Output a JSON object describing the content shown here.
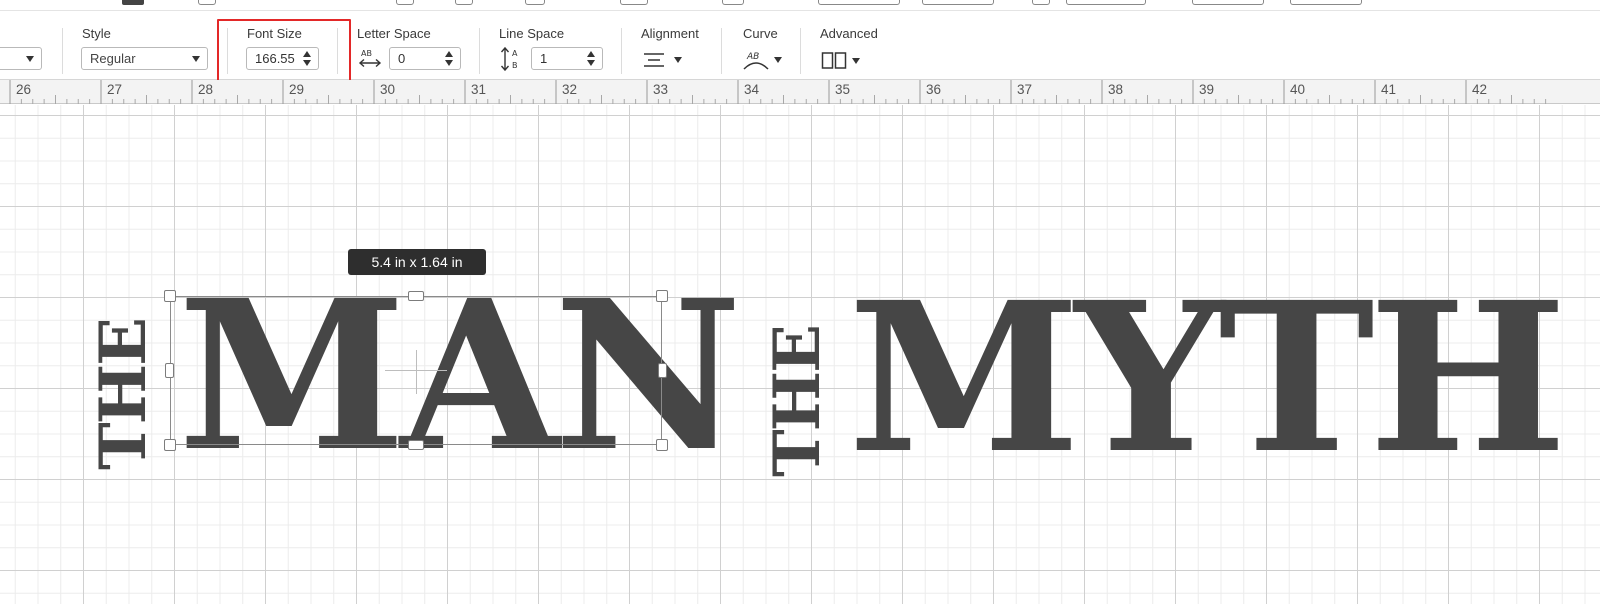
{
  "toolbar": {
    "font_dropdown": {
      "value": ""
    },
    "style": {
      "label": "Style",
      "value": "Regular"
    },
    "font_size": {
      "label": "Font Size",
      "value": "166.55"
    },
    "letter_space": {
      "label": "Letter Space",
      "value": "0",
      "icon": "letter-space-icon",
      "icon_text": "AB"
    },
    "line_space": {
      "label": "Line Space",
      "value": "1",
      "icon": "line-space-icon",
      "icon_text_a": "A",
      "icon_text_b": "B"
    },
    "alignment": {
      "label": "Alignment",
      "icon": "align-center-icon"
    },
    "curve": {
      "label": "Curve",
      "icon": "curve-text-icon",
      "icon_text": "AB"
    },
    "advanced": {
      "label": "Advanced",
      "icon": "advanced-icon"
    },
    "highlight_color": "#e32828"
  },
  "ruler": {
    "labels": [
      "26",
      "27",
      "28",
      "29",
      "30",
      "31",
      "32",
      "33",
      "34",
      "35",
      "36",
      "37",
      "38",
      "39",
      "40",
      "41",
      "42"
    ]
  },
  "canvas": {
    "text_color": "#464646",
    "group_left": {
      "small": "THE",
      "big": "MAN"
    },
    "group_right": {
      "small": "THE",
      "big": "MYTH"
    },
    "dimension_tooltip": "5.4  in x 1.64  in"
  }
}
